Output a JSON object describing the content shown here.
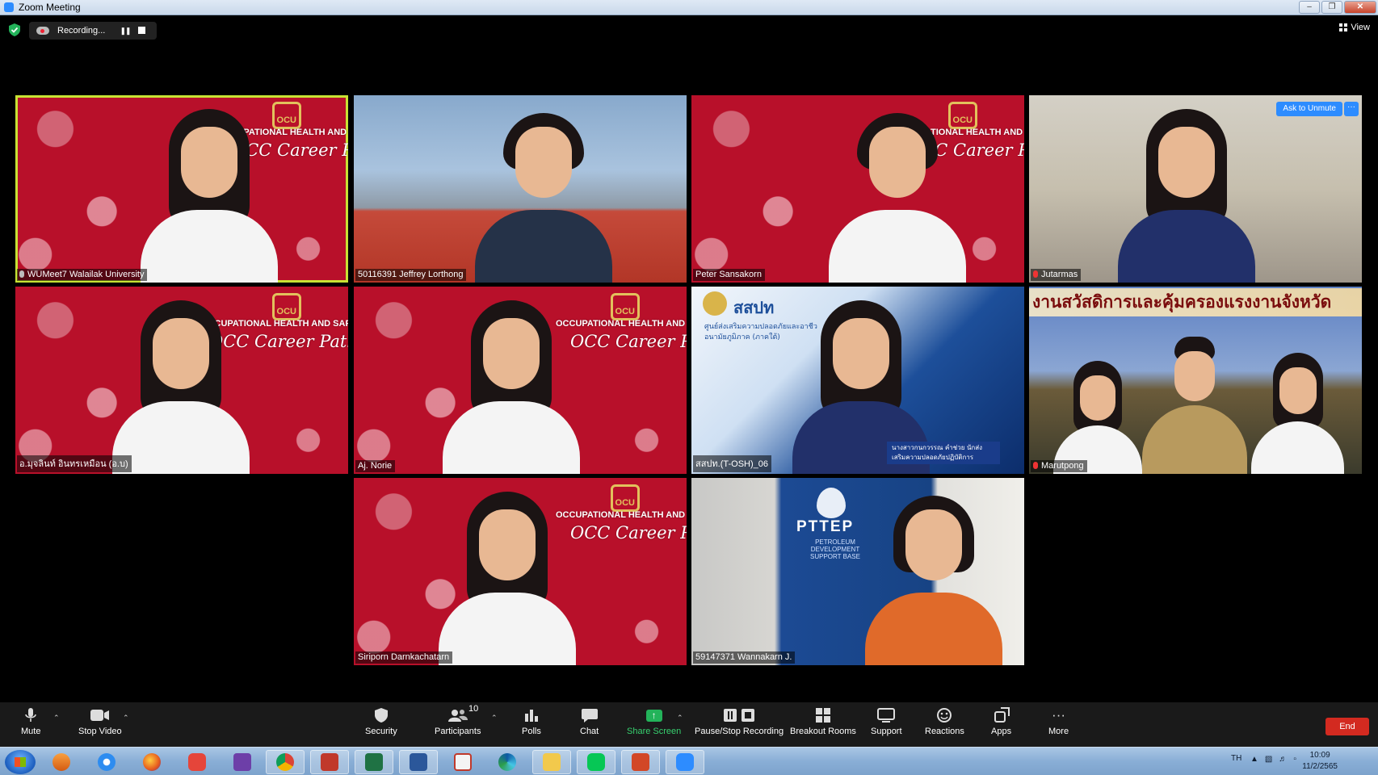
{
  "window": {
    "title": "Zoom Meeting",
    "controls": [
      "minimize",
      "restore",
      "close"
    ]
  },
  "topbar": {
    "recording_label": "Recording...",
    "view_label": "View"
  },
  "participants": [
    {
      "name": "WUMeet7 Walailak University",
      "background": "valentine",
      "active_speaker": true,
      "muted": false,
      "pinned_icon": true
    },
    {
      "name": "50116391 Jeffrey Lorthong",
      "background": "building",
      "active_speaker": false
    },
    {
      "name": "Peter Sansakorn",
      "background": "valentine",
      "active_speaker": false
    },
    {
      "name": "Jutarmas",
      "background": "office",
      "muted": true,
      "ask_to_unmute": "Ask to Unmute",
      "more_label": "···"
    },
    {
      "name": "อ.มุจลินท์ อินทรเหมือน (อ.บ)",
      "background": "valentine"
    },
    {
      "name": "Aj. Norie",
      "background": "valentine"
    },
    {
      "name": "สสปท.(T-OSH)_06",
      "background": "osh"
    },
    {
      "name": "Marutpong",
      "background": "temple",
      "muted": true
    },
    {
      "name": "Siriporn Darnkachatarn",
      "background": "valentine"
    },
    {
      "name": "59147371 Wannakarn J.",
      "background": "pttep"
    }
  ],
  "backgrounds": {
    "valentine": {
      "line1": "OCCUPATIONAL HEALTH AND SAFETY",
      "line2": "OCC Career Path",
      "logo": "OCU"
    },
    "osh": {
      "title": "สสปท",
      "subtitle": "ศูนย์ส่งเสริมความปลอดภัยและอาชีวอนามัยภูมิภาค (ภาคใต้)",
      "caption": "นางสาวกนกวรรณ คำช่วย นักส่งเสริมความปลอดภัยปฏิบัติการ"
    },
    "temple": {
      "banner": "งานสวัสดิการและคุ้มครองแรงงานจังหวัด"
    },
    "pttep": {
      "logo": "PTTEP",
      "subtitle": "PETROLEUM DEVELOPMENT SUPPORT BASE"
    }
  },
  "toolbar": {
    "mute": "Mute",
    "stop_video": "Stop Video",
    "security": "Security",
    "participants": "Participants",
    "participants_count": "10",
    "polls": "Polls",
    "chat": "Chat",
    "share_screen": "Share Screen",
    "pause_stop_recording": "Pause/Stop Recording",
    "breakout_rooms": "Breakout Rooms",
    "support": "Support",
    "reactions": "Reactions",
    "apps": "Apps",
    "more": "More",
    "end": "End"
  },
  "taskbar": {
    "apps": [
      "media-player",
      "internet-explorer",
      "firefox",
      "bandicam",
      "visual-studio",
      "chrome",
      "app-red",
      "excel",
      "word",
      "acrobat",
      "edge",
      "explorer",
      "line",
      "powerpoint",
      "zoom"
    ],
    "language": "TH",
    "time": "10:09",
    "date": "11/2/2565"
  },
  "colors": {
    "active_speaker_border": "#c8e234",
    "zoom_blue": "#2d8cff",
    "end_red": "#d32a20",
    "share_green": "#23b35a"
  }
}
